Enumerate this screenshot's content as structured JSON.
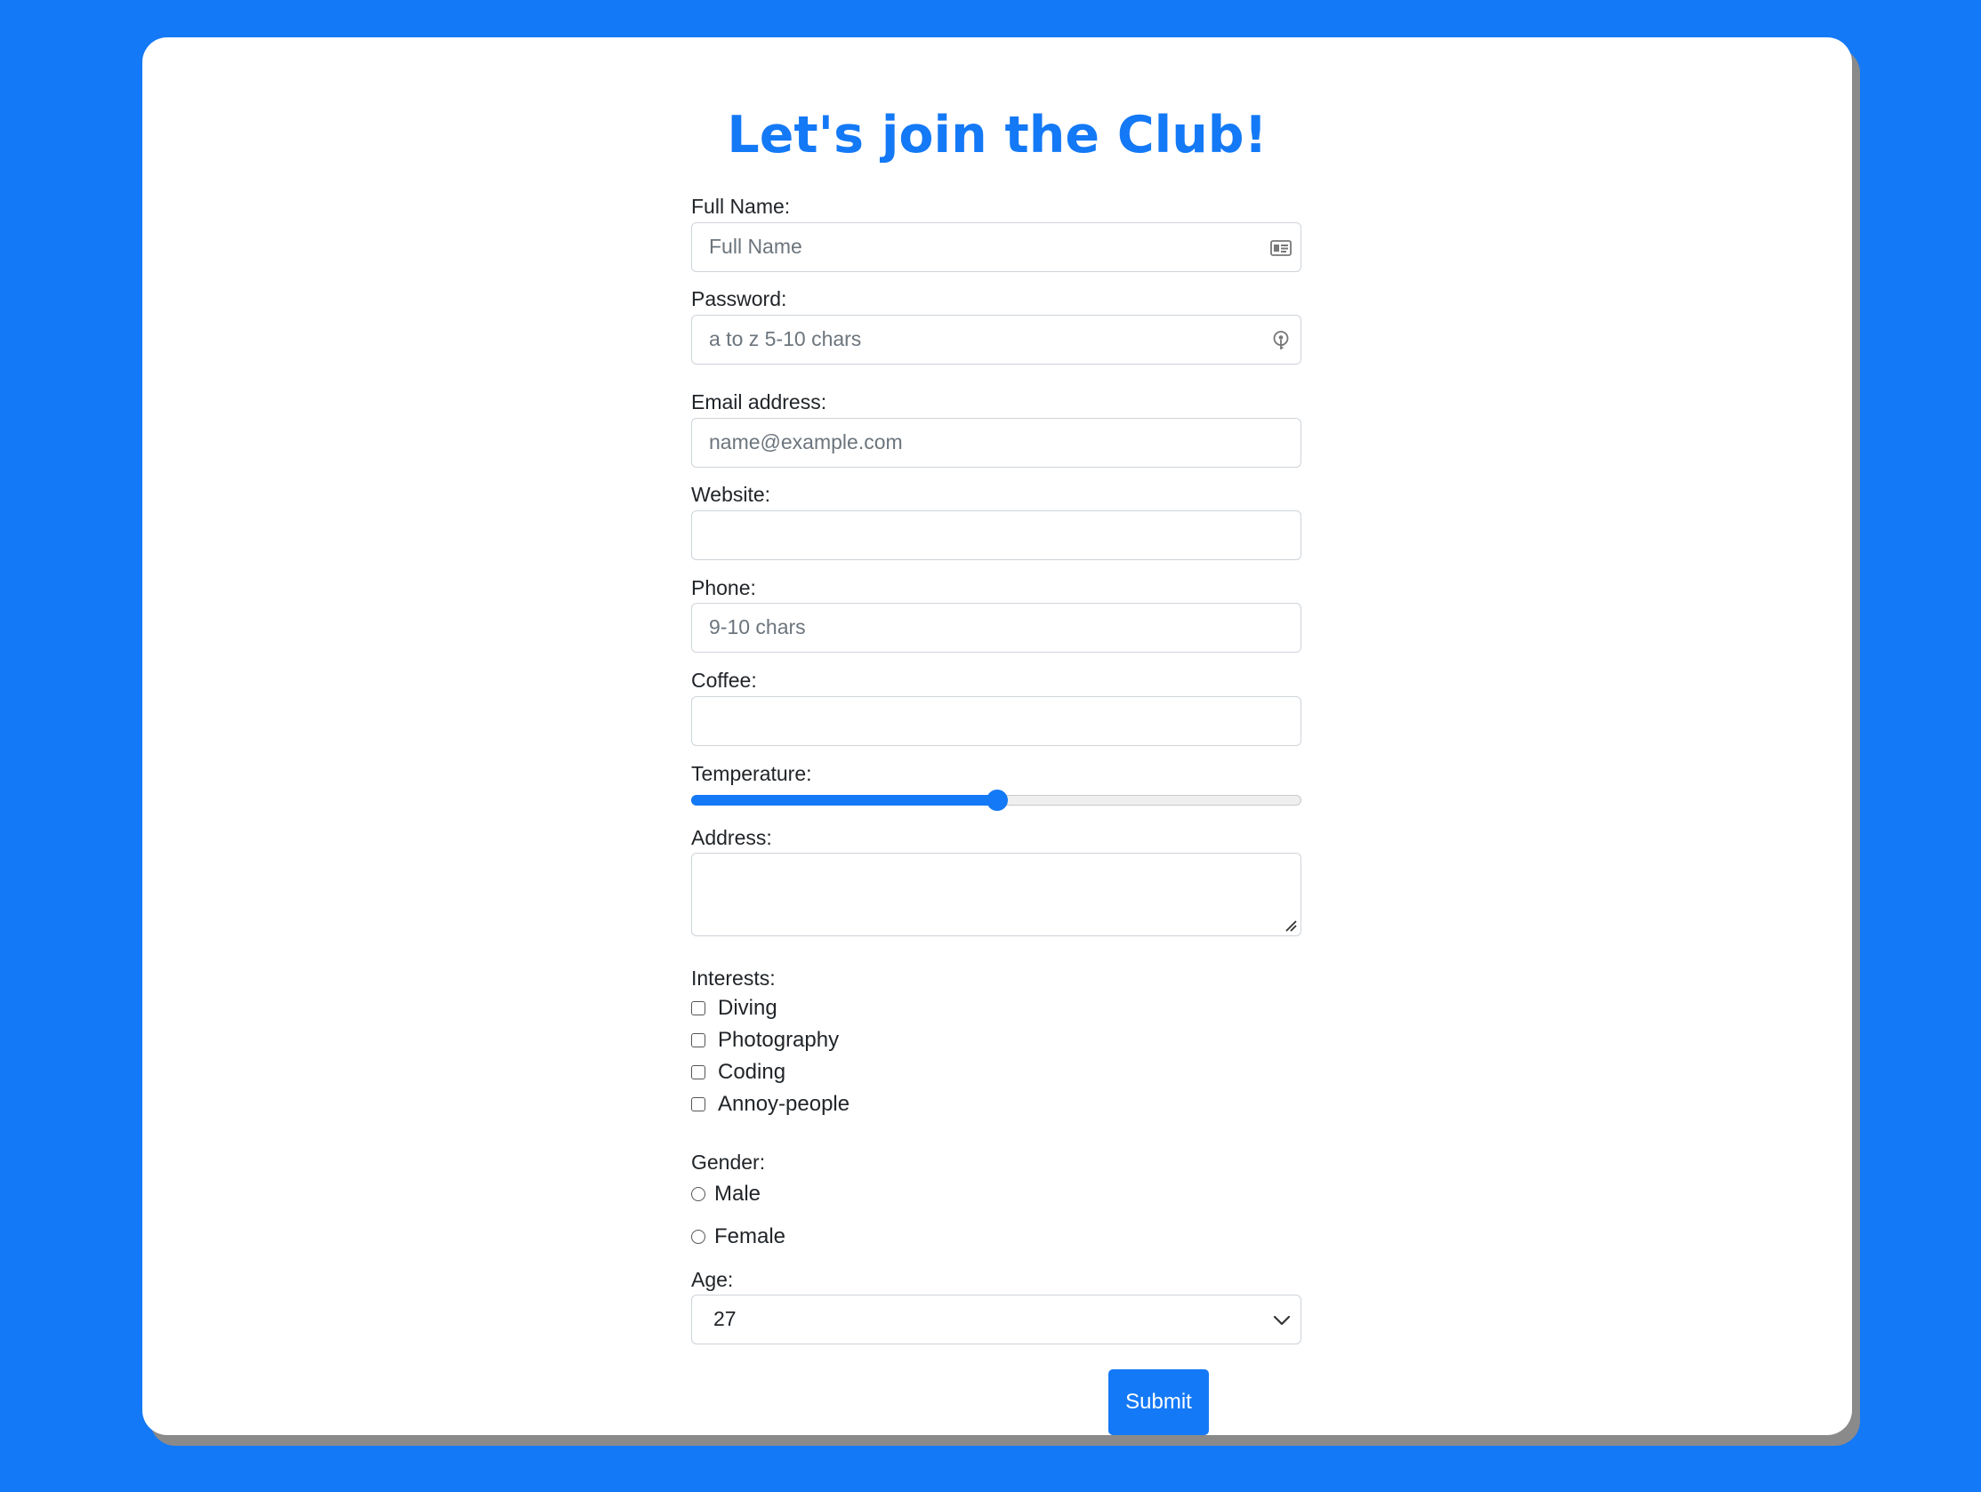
{
  "page": {
    "title": "Let's join the Club!",
    "accent_color": "#1479f6"
  },
  "form": {
    "full_name": {
      "label": "Full Name:",
      "placeholder": "Full Name",
      "icon": "id-card-icon"
    },
    "password": {
      "label": "Password:",
      "placeholder": "a to z 5-10 chars",
      "icon": "key-icon"
    },
    "email": {
      "label": "Email address:",
      "placeholder": "name@example.com"
    },
    "website": {
      "label": "Website:",
      "value": ""
    },
    "phone": {
      "label": "Phone:",
      "placeholder": "9-10 chars"
    },
    "coffee": {
      "label": "Coffee:",
      "value": ""
    },
    "temperature": {
      "label": "Temperature:",
      "fraction": 0.5
    },
    "address": {
      "label": "Address:",
      "value": ""
    },
    "interests": {
      "label": "Interests:",
      "options": [
        "Diving",
        "Photography",
        "Coding",
        "Annoy-people"
      ]
    },
    "gender": {
      "label": "Gender:",
      "options": [
        "Male",
        "Female"
      ]
    },
    "age": {
      "label": "Age:",
      "value": "27"
    },
    "submit_label": "Submit"
  }
}
